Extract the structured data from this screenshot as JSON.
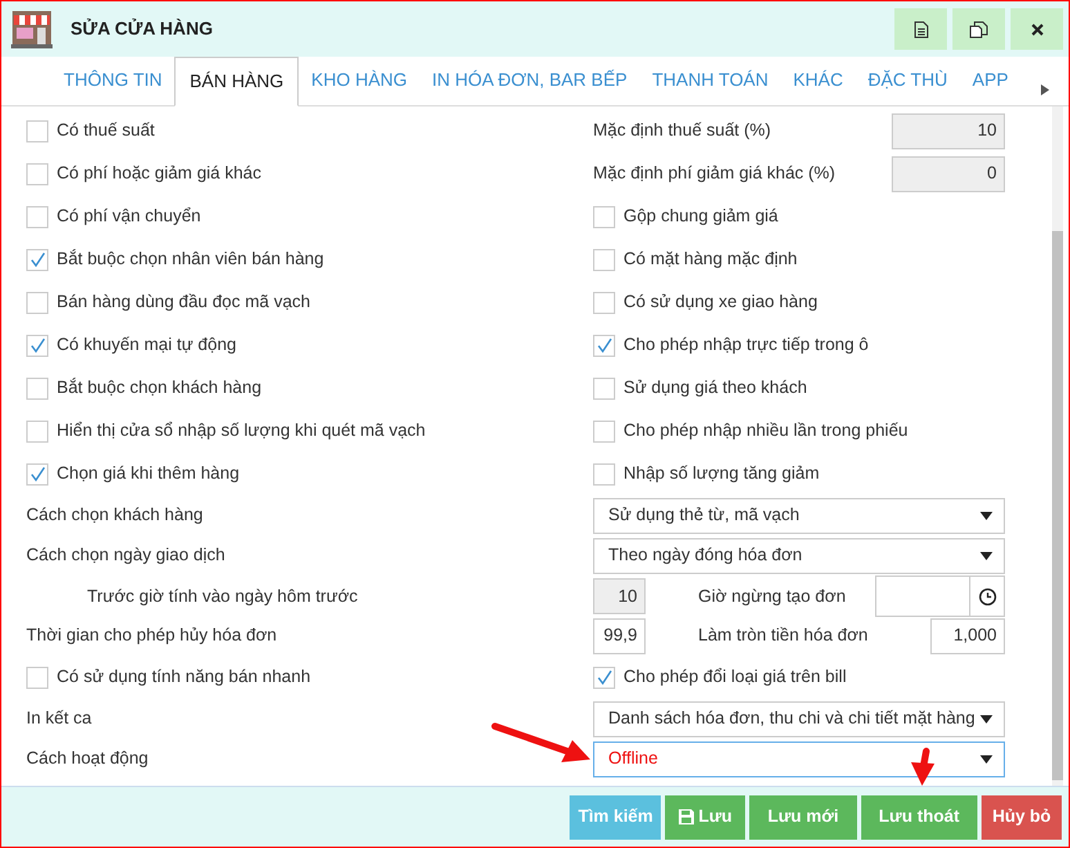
{
  "window": {
    "title": "SỬA CỬA HÀNG"
  },
  "tabs": [
    {
      "label": "THÔNG TIN",
      "selected": false
    },
    {
      "label": "BÁN HÀNG",
      "selected": true
    },
    {
      "label": "KHO HÀNG",
      "selected": false
    },
    {
      "label": "IN HÓA ĐƠN, BAR BẾP",
      "selected": false
    },
    {
      "label": "THANH TOÁN",
      "selected": false
    },
    {
      "label": "KHÁC",
      "selected": false
    },
    {
      "label": "ĐẶC THÙ",
      "selected": false
    },
    {
      "label": "APP",
      "selected": false
    }
  ],
  "rows": [
    {
      "left": {
        "kind": "checkbox",
        "label": "Có thuế suất",
        "checked": false
      },
      "right": {
        "kind": "number",
        "label": "Mặc định thuế suất (%)",
        "value": "10",
        "disabled": true
      }
    },
    {
      "left": {
        "kind": "checkbox",
        "label": "Có phí hoặc giảm giá khác",
        "checked": false
      },
      "right": {
        "kind": "number",
        "label": "Mặc định phí giảm giá khác (%)",
        "value": "0",
        "disabled": true
      }
    },
    {
      "left": {
        "kind": "checkbox",
        "label": "Có phí vận chuyển",
        "checked": false
      },
      "right": {
        "kind": "checkbox",
        "label": "Gộp chung giảm giá",
        "checked": false
      }
    },
    {
      "left": {
        "kind": "checkbox",
        "label": "Bắt buộc chọn nhân viên bán hàng",
        "checked": true
      },
      "right": {
        "kind": "checkbox",
        "label": "Có mặt hàng mặc định",
        "checked": false
      }
    },
    {
      "left": {
        "kind": "checkbox",
        "label": "Bán hàng dùng đầu đọc mã vạch",
        "checked": false
      },
      "right": {
        "kind": "checkbox",
        "label": "Có sử dụng xe giao hàng",
        "checked": false
      }
    },
    {
      "left": {
        "kind": "checkbox",
        "label": "Có khuyến mại tự động",
        "checked": true
      },
      "right": {
        "kind": "checkbox",
        "label": "Cho phép nhập trực tiếp trong ô",
        "checked": true
      }
    },
    {
      "left": {
        "kind": "checkbox",
        "label": "Bắt buộc chọn khách hàng",
        "checked": false
      },
      "right": {
        "kind": "checkbox",
        "label": "Sử dụng giá theo khách",
        "checked": false
      }
    },
    {
      "left": {
        "kind": "checkbox",
        "label": "Hiển thị cửa sổ nhập số lượng khi quét mã vạch",
        "checked": false
      },
      "right": {
        "kind": "checkbox",
        "label": "Cho phép nhập nhiều lần trong phiếu",
        "checked": false
      }
    },
    {
      "left": {
        "kind": "checkbox",
        "label": "Chọn giá khi thêm hàng",
        "checked": true
      },
      "right": {
        "kind": "checkbox",
        "label": "Nhập số lượng tăng giảm",
        "checked": false
      }
    },
    {
      "left": {
        "kind": "label",
        "label": "Cách chọn khách hàng"
      },
      "right": {
        "kind": "select",
        "value": "Sử dụng thẻ từ, mã vạch",
        "focused": false
      }
    },
    {
      "left": {
        "kind": "label",
        "label": "Cách chọn ngày giao dịch"
      },
      "right": {
        "kind": "select",
        "value": "Theo ngày đóng hóa đơn",
        "focused": false
      }
    },
    {
      "left": {
        "kind": "indented",
        "label": "Trước giờ tính vào ngày hôm trước"
      },
      "right": {
        "kind": "pair",
        "value": "10",
        "disabled": true,
        "label": "Giờ ngừng tạo đơn",
        "field": {
          "kind": "time"
        }
      }
    },
    {
      "left": {
        "kind": "label",
        "label": "Thời gian cho phép hủy hóa đơn"
      },
      "right": {
        "kind": "pair",
        "value": "99,9",
        "disabled": false,
        "label": "Làm tròn tiền hóa đơn",
        "field": {
          "kind": "number",
          "value": "1,000"
        }
      }
    },
    {
      "left": {
        "kind": "checkbox",
        "label": "Có sử dụng tính năng bán nhanh",
        "checked": false
      },
      "right": {
        "kind": "checkbox",
        "label": "Cho phép đổi loại giá trên bill",
        "checked": true
      }
    },
    {
      "left": {
        "kind": "label",
        "label": "In kết ca"
      },
      "right": {
        "kind": "select",
        "value": "Danh sách hóa đơn, thu chi và chi tiết mặt hàng",
        "focused": false
      }
    },
    {
      "left": {
        "kind": "label",
        "label": "Cách hoạt động"
      },
      "right": {
        "kind": "select",
        "value": "Offline",
        "focused": true
      }
    }
  ],
  "buttons": [
    {
      "label": "Tìm kiếm",
      "kind": "info"
    },
    {
      "label": "Lưu",
      "kind": "save"
    },
    {
      "label": "Lưu mới",
      "kind": "success"
    },
    {
      "label": "Lưu thoát",
      "kind": "success"
    },
    {
      "label": "Hủy bỏ",
      "kind": "danger"
    }
  ]
}
